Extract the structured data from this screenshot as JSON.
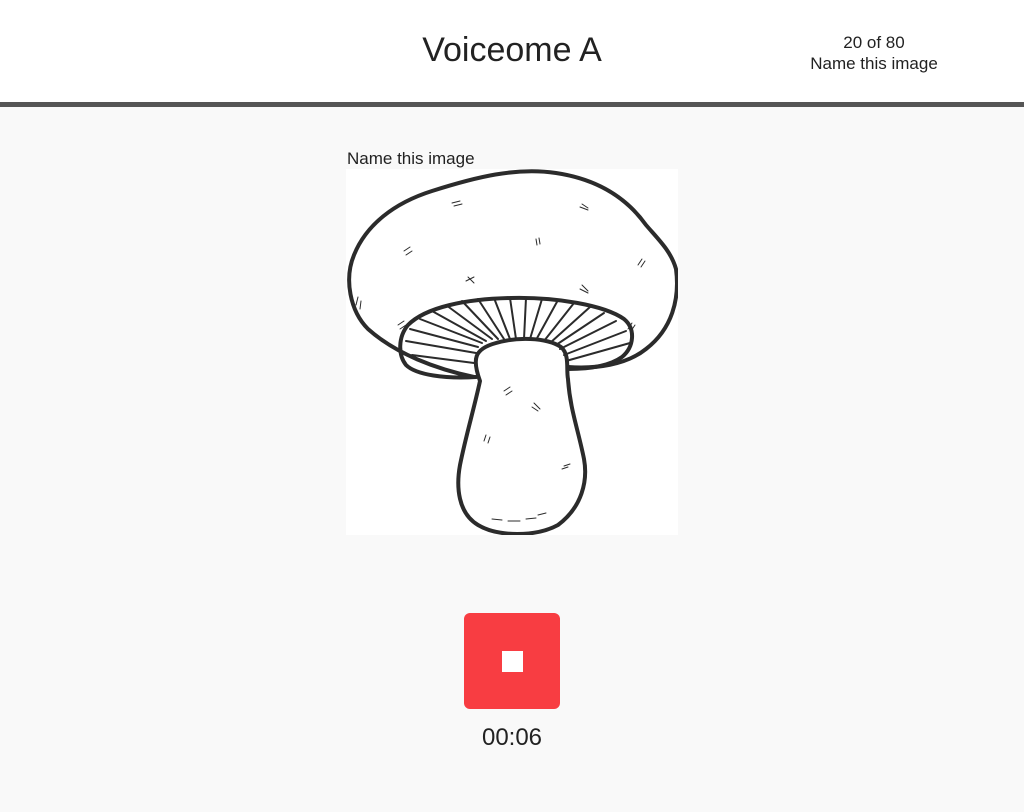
{
  "header": {
    "title": "Voiceome A",
    "progress": {
      "count": "20 of 80",
      "task": "Name this image"
    }
  },
  "task": {
    "prompt": "Name this image",
    "image_subject": "mushroom-illustration"
  },
  "recorder": {
    "button_icon": "stop-icon",
    "button_color": "#f83d42",
    "elapsed": "00:06"
  }
}
